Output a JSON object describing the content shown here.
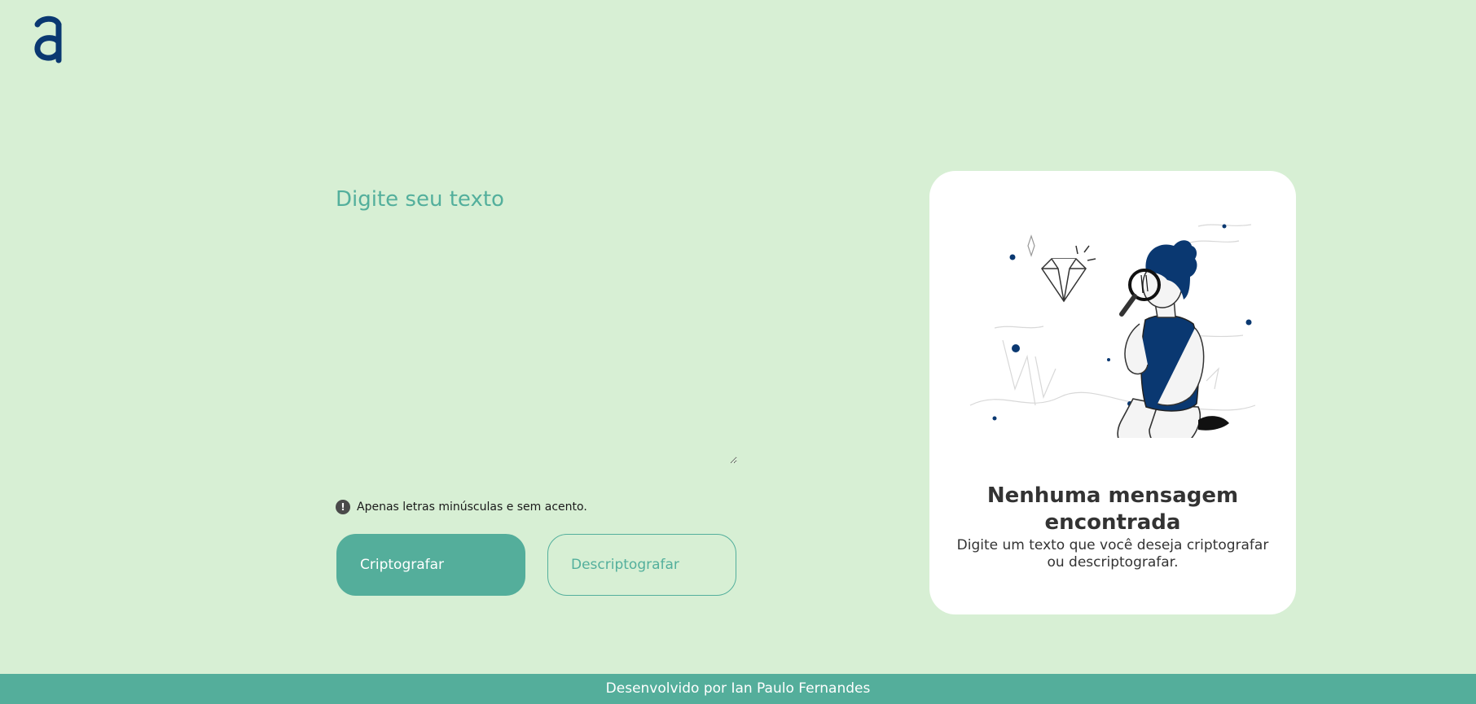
{
  "app": {
    "logo_icon": "alura-a-logo-icon",
    "brand_color": "#0a3871",
    "accent_color": "#54ae9b",
    "background_color": "#d7efd4"
  },
  "input": {
    "placeholder": "Digite seu texto",
    "value": ""
  },
  "hint": {
    "icon": "exclamation-circle-icon",
    "text": "Apenas letras minúsculas e sem acento."
  },
  "buttons": {
    "encrypt_label": "Criptografar",
    "decrypt_label": "Descriptografar"
  },
  "output": {
    "illustration": "person-with-magnifying-glass-illustration",
    "title": "Nenhuma mensagem encontrada",
    "description": "Digite um texto que você deseja criptografar ou descriptografar."
  },
  "footer": {
    "text": "Desenvolvido por Ian Paulo Fernandes"
  }
}
